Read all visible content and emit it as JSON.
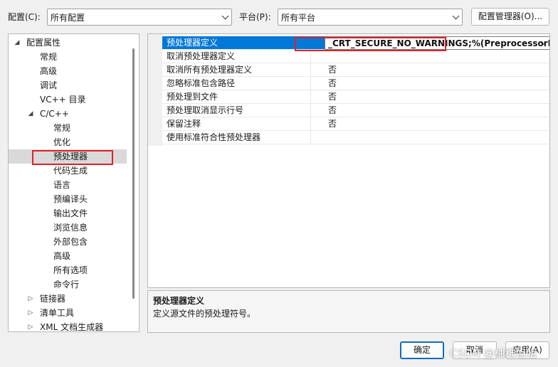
{
  "header": {
    "config_label": "配置(C):",
    "config_value": "所有配置",
    "platform_label": "平台(P):",
    "platform_value": "所有平台",
    "config_manager_button": "配置管理器(O)..."
  },
  "tree": {
    "items": [
      {
        "label": "配置属性",
        "expander": "◢",
        "expanded": true
      },
      {
        "label": "常规"
      },
      {
        "label": "高级"
      },
      {
        "label": "调试"
      },
      {
        "label": "VC++ 目录"
      },
      {
        "label": "C/C++",
        "expander": "◢",
        "expanded": true
      },
      {
        "label": "常规"
      },
      {
        "label": "优化"
      },
      {
        "label": "预处理器",
        "selected": true
      },
      {
        "label": "代码生成"
      },
      {
        "label": "语言"
      },
      {
        "label": "预编译头"
      },
      {
        "label": "输出文件"
      },
      {
        "label": "浏览信息"
      },
      {
        "label": "外部包含"
      },
      {
        "label": "高级"
      },
      {
        "label": "所有选项"
      },
      {
        "label": "命令行"
      },
      {
        "label": "链接器",
        "expander": "▷"
      },
      {
        "label": "清单工具",
        "expander": "▷"
      },
      {
        "label": "XML 文档生成器",
        "expander": "▷"
      }
    ]
  },
  "grid": {
    "rows": [
      {
        "name": "预处理器定义",
        "value": "_CRT_SECURE_NO_WARNINGS;%(PreprocessorDefini",
        "selected": true
      },
      {
        "name": "取消预处理器定义",
        "value": ""
      },
      {
        "name": "取消所有预处理器定义",
        "value": "否"
      },
      {
        "name": "忽略标准包含路径",
        "value": "否"
      },
      {
        "name": "预处理到文件",
        "value": "否"
      },
      {
        "name": "预处理取消显示行号",
        "value": "否"
      },
      {
        "name": "保留注释",
        "value": "否"
      },
      {
        "name": "使用标准符合性预处理器",
        "value": ""
      }
    ]
  },
  "description": {
    "title": "预处理器定义",
    "text": "定义源文件的预处理符号。"
  },
  "footer": {
    "ok": "确定",
    "cancel": "取消",
    "apply": "应用(A)"
  },
  "watermark": "CSDN @柚稚姐姐",
  "colors": {
    "selection": "#0078d7",
    "highlight_box": "#e0202a"
  }
}
